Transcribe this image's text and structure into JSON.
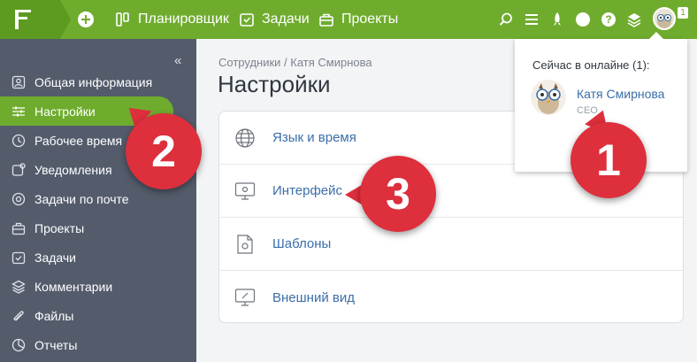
{
  "topbar": {
    "nav": [
      {
        "label": "Планировщик",
        "icon": "planner-icon"
      },
      {
        "label": "Задачи",
        "icon": "tasks-icon"
      },
      {
        "label": "Проекты",
        "icon": "projects-icon"
      }
    ],
    "online_count": "1"
  },
  "sidebar": {
    "collapse_glyph": "«",
    "items": [
      {
        "label": "Общая информация",
        "icon": "person-icon"
      },
      {
        "label": "Настройки",
        "icon": "settings-sliders-icon"
      },
      {
        "label": "Рабочее время",
        "icon": "clock-icon"
      },
      {
        "label": "Уведомления",
        "icon": "notifications-icon"
      },
      {
        "label": "Задачи по почте",
        "icon": "mail-icon"
      },
      {
        "label": "Проекты",
        "icon": "projects-icon"
      },
      {
        "label": "Задачи",
        "icon": "tasks-icon"
      },
      {
        "label": "Комментарии",
        "icon": "layers-icon"
      },
      {
        "label": "Файлы",
        "icon": "files-icon"
      },
      {
        "label": "Отчеты",
        "icon": "reports-icon"
      }
    ]
  },
  "main": {
    "breadcrumb": "Сотрудники / Катя Смирнова",
    "title": "Настройки",
    "settings_rows": [
      {
        "label": "Язык и время",
        "icon": "globe-icon"
      },
      {
        "label": "Интерфейс",
        "icon": "monitor-gear-icon"
      },
      {
        "label": "Шаблоны",
        "icon": "document-gear-icon"
      },
      {
        "label": "Внешний вид",
        "icon": "monitor-brush-icon"
      }
    ]
  },
  "online_popup": {
    "title": "Сейчас в онлайне (1):",
    "user_name": "Катя Смирнова",
    "user_role": "CEO"
  },
  "callouts": [
    "1",
    "2",
    "3"
  ],
  "colors": {
    "brand_green": "#6fac2e",
    "sidebar_bg": "#545c6c",
    "link_blue": "#3a6ea8",
    "callout_red": "#dd2f3c"
  }
}
